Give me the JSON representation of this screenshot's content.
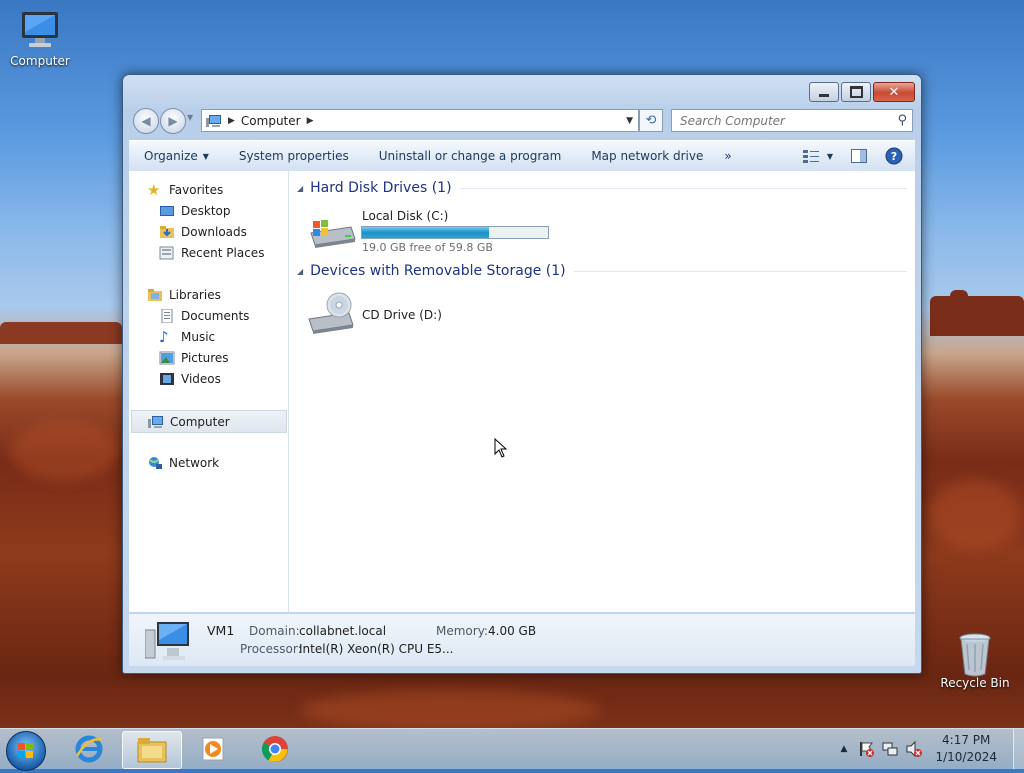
{
  "desktop": {
    "computer_label": "Computer",
    "recycle_label": "Recycle Bin"
  },
  "window": {
    "address": {
      "segment": "Computer"
    },
    "search": {
      "placeholder": "Search Computer"
    },
    "toolbar": {
      "organize": "Organize",
      "system_properties": "System properties",
      "uninstall": "Uninstall or change a program",
      "map_drive": "Map network drive",
      "more": "»"
    },
    "nav": {
      "favorites": "Favorites",
      "desktop": "Desktop",
      "downloads": "Downloads",
      "recent": "Recent Places",
      "libraries": "Libraries",
      "documents": "Documents",
      "music": "Music",
      "pictures": "Pictures",
      "videos": "Videos",
      "computer": "Computer",
      "network": "Network"
    },
    "groups": {
      "hdd_title": "Hard Disk Drives (1)",
      "removable_title": "Devices with Removable Storage (1)"
    },
    "drives": {
      "c_name": "Local Disk (C:)",
      "c_free": "19.0 GB free of 59.8 GB",
      "c_used_fraction": 0.682,
      "d_name": "CD Drive (D:)"
    },
    "details": {
      "name": "VM1",
      "domain_label": "Domain:",
      "domain_value": "collabnet.local",
      "memory_label": "Memory:",
      "memory_value": "4.00 GB",
      "processor_label": "Processor:",
      "processor_value": "Intel(R) Xeon(R) CPU E5..."
    }
  },
  "taskbar": {
    "time": "4:17 PM",
    "date": "1/10/2024"
  },
  "colors": {
    "accent": "#1e3287",
    "progress": "#2a90c4"
  }
}
